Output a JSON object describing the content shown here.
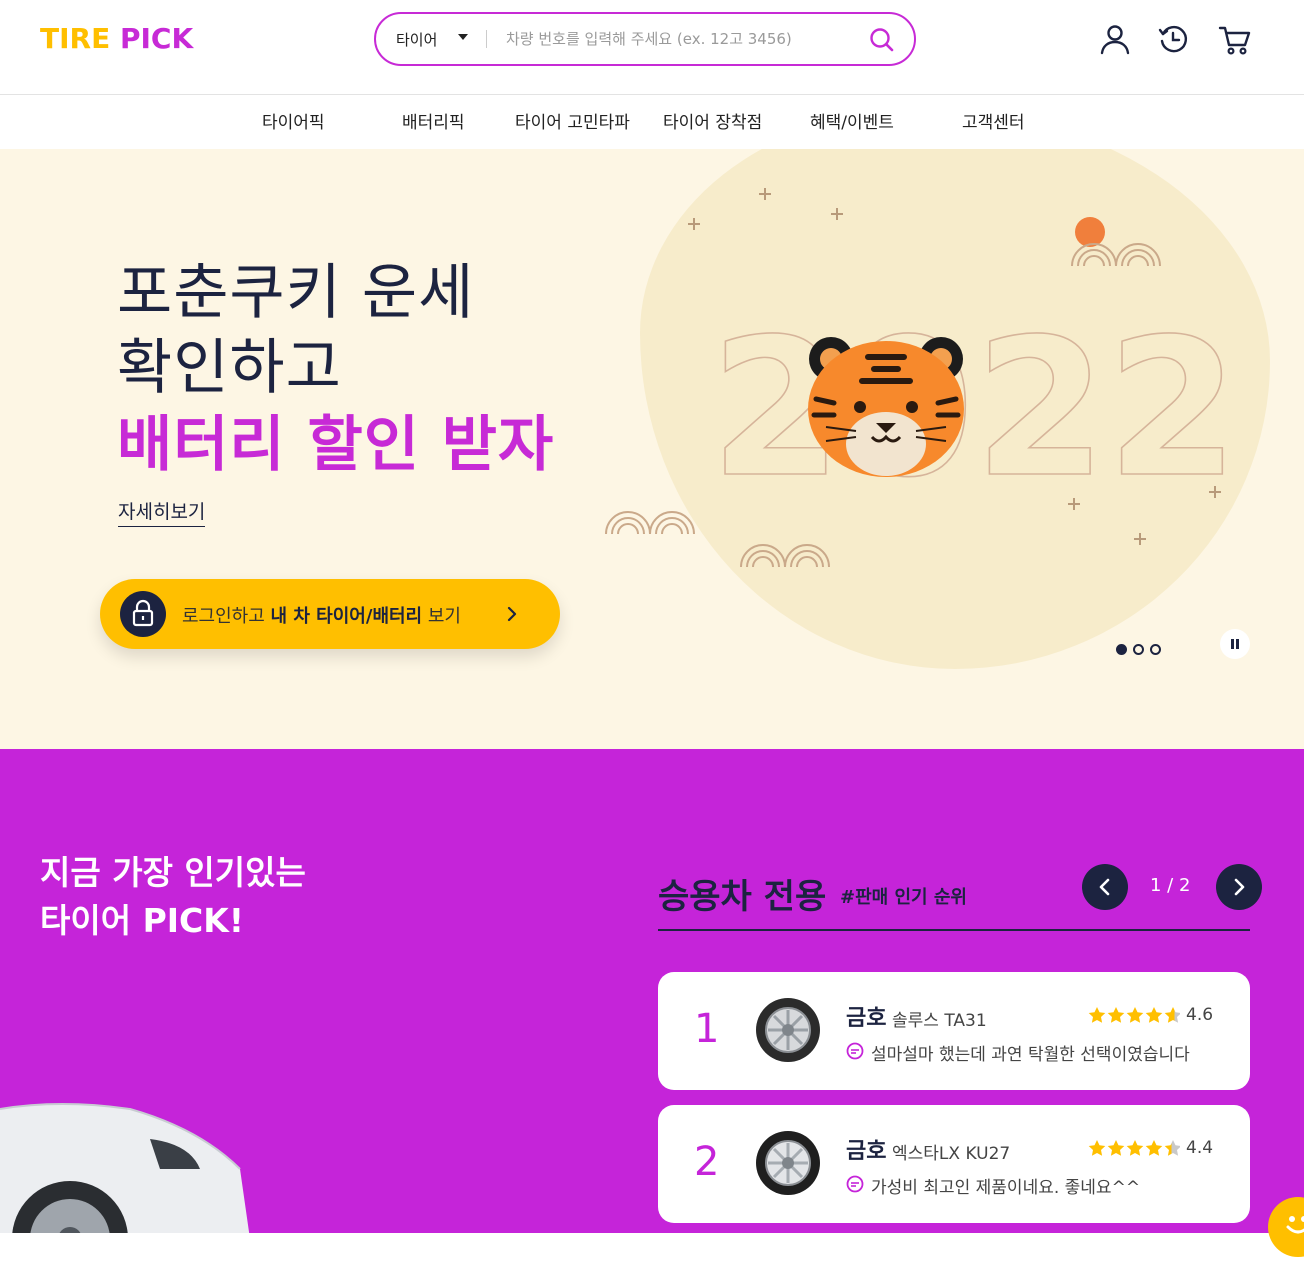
{
  "logo": {
    "part1": "TIRE",
    "part2": "PICK"
  },
  "search": {
    "category": "타이어",
    "placeholder": "차량 번호를 입력해 주세요 (ex. 12고 3456)"
  },
  "nav": {
    "items": [
      "타이어픽",
      "배터리픽",
      "타이어 고민타파",
      "타이어 장착점",
      "혜택/이벤트",
      "고객센터"
    ]
  },
  "hero": {
    "line1": "포춘쿠키 운세",
    "line2": "확인하고",
    "line3": "배터리 할인 받자",
    "more": "자세히보기",
    "cta_pre": "로그인하고 ",
    "cta_bold": "내 차 타이어/배터리",
    "cta_post": " 보기",
    "year": "2022"
  },
  "popular": {
    "title_line1": "지금 가장 인기있는",
    "title_line2": "타이어 PICK!",
    "rank_title": "승용차 전용",
    "rank_sub": "#판매 인기 순위",
    "page": "1 / 2",
    "items": [
      {
        "rank": "1",
        "brand": "금호",
        "model": "솔루스 TA31",
        "score": "4.6",
        "rating": 4.6,
        "review": "설마설마 했는데 과연 탁월한 선택이였습니다"
      },
      {
        "rank": "2",
        "brand": "금호",
        "model": "엑스타LX KU27",
        "score": "4.4",
        "rating": 4.4,
        "review": "가성비 최고인 제품이네요. 좋네요^^"
      }
    ]
  },
  "colors": {
    "brand_purple": "#c524d9",
    "brand_yellow": "#ffbf00",
    "navy": "#1c2340",
    "cream": "#fdf6e4"
  }
}
